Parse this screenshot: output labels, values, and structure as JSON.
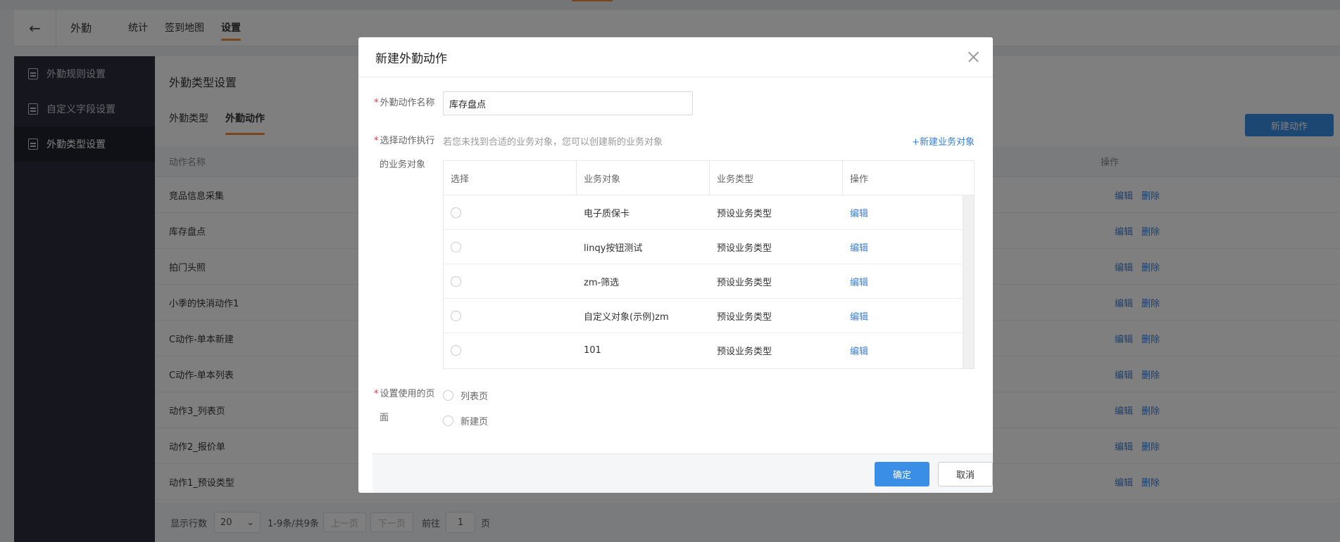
{
  "header": {
    "app_name": "外勤",
    "tabs": [
      {
        "label": "统计"
      },
      {
        "label": "签到地图"
      },
      {
        "label": "设置"
      }
    ]
  },
  "sidebar": {
    "items": [
      {
        "label": "外勤规则设置"
      },
      {
        "label": "自定义字段设置"
      },
      {
        "label": "外勤类型设置"
      }
    ]
  },
  "main": {
    "title": "外勤类型设置",
    "tabs": [
      {
        "label": "外勤类型"
      },
      {
        "label": "外勤动作"
      }
    ],
    "new_button": "新建动作",
    "columns": {
      "name": "动作名称",
      "ops": "操作"
    },
    "rows": [
      {
        "name": "竞品信息采集"
      },
      {
        "name": "库存盘点"
      },
      {
        "name": "拍门头照"
      },
      {
        "name": "小季的快消动作1"
      },
      {
        "name": "C动作-单本新建"
      },
      {
        "name": "C动作-单本列表"
      },
      {
        "name": "动作3_列表页"
      },
      {
        "name": "动作2_报价单"
      },
      {
        "name": "动作1_预设类型"
      }
    ],
    "row_edit": "编辑",
    "row_delete": "删除",
    "pagination": {
      "rows_label": "显示行数",
      "page_size": "20",
      "summary": "1-9条/共9条",
      "prev": "上一页",
      "next": "下一页",
      "goto_label": "前往",
      "page": "1",
      "page_suffix": "页"
    }
  },
  "modal": {
    "title": "新建外勤动作",
    "required_mark": "*",
    "name_label": "外勤动作名称",
    "name_value": "库存盘点",
    "object_label_1": "选择动作执行",
    "object_label_2": "的业务对象",
    "hint": "若您未找到合适的业务对象，您可以创建新的业务对象",
    "new_object_link": "+新建业务对象",
    "table": {
      "headers": [
        "选择",
        "业务对象",
        "业务类型",
        "操作"
      ],
      "rows": [
        {
          "object": "电子质保卡",
          "type": "预设业务类型",
          "op": "编辑"
        },
        {
          "object": "linqy按钮测试",
          "type": "预设业务类型",
          "op": "编辑"
        },
        {
          "object": "zm-筛选",
          "type": "预设业务类型",
          "op": "编辑"
        },
        {
          "object": "自定义对象(示例)zm",
          "type": "预设业务类型",
          "op": "编辑"
        },
        {
          "object": "101",
          "type": "预设业务类型",
          "op": "编辑"
        }
      ]
    },
    "page_label_1": "设置使用的页",
    "page_label_2": "面",
    "page_options": [
      {
        "label": "列表页"
      },
      {
        "label": "新建页"
      }
    ],
    "ok": "确定",
    "cancel": "取消"
  },
  "colors": {
    "primary": "#3a8ee6",
    "accent": "#f08a3a",
    "sidebar": "#2c2f3d",
    "required": "#e4393c"
  }
}
